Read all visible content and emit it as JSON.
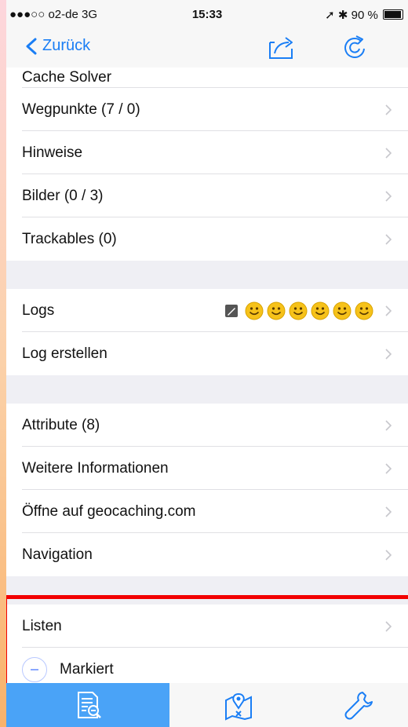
{
  "status_bar": {
    "carrier": "●●●○○ o2-de  3G",
    "time": "15:33",
    "battery": "90 %"
  },
  "nav": {
    "back_label": "Zurück"
  },
  "rows": {
    "cache_solver": "Cache Solver",
    "waypoints": "Wegpunkte (7 / 0)",
    "hints": "Hinweise",
    "images": "Bilder (0 / 3)",
    "trackables": "Trackables (0)",
    "logs": "Logs",
    "create_log": "Log erstellen",
    "attributes": "Attribute (8)",
    "more_info": "Weitere Informationen",
    "open_geocaching": "Öffne auf geocaching.com",
    "navigation": "Navigation",
    "lists": "Listen",
    "marked": "Markiert"
  },
  "colors": {
    "accent": "#1a7ef5",
    "highlight": "#f20000",
    "tab_active": "#4aa3f7",
    "smiley": "#f6c21a"
  },
  "tabs": [
    {
      "icon": "cache-details-icon",
      "active": true
    },
    {
      "icon": "map-pin-icon",
      "active": false
    },
    {
      "icon": "wrench-icon",
      "active": false
    }
  ]
}
